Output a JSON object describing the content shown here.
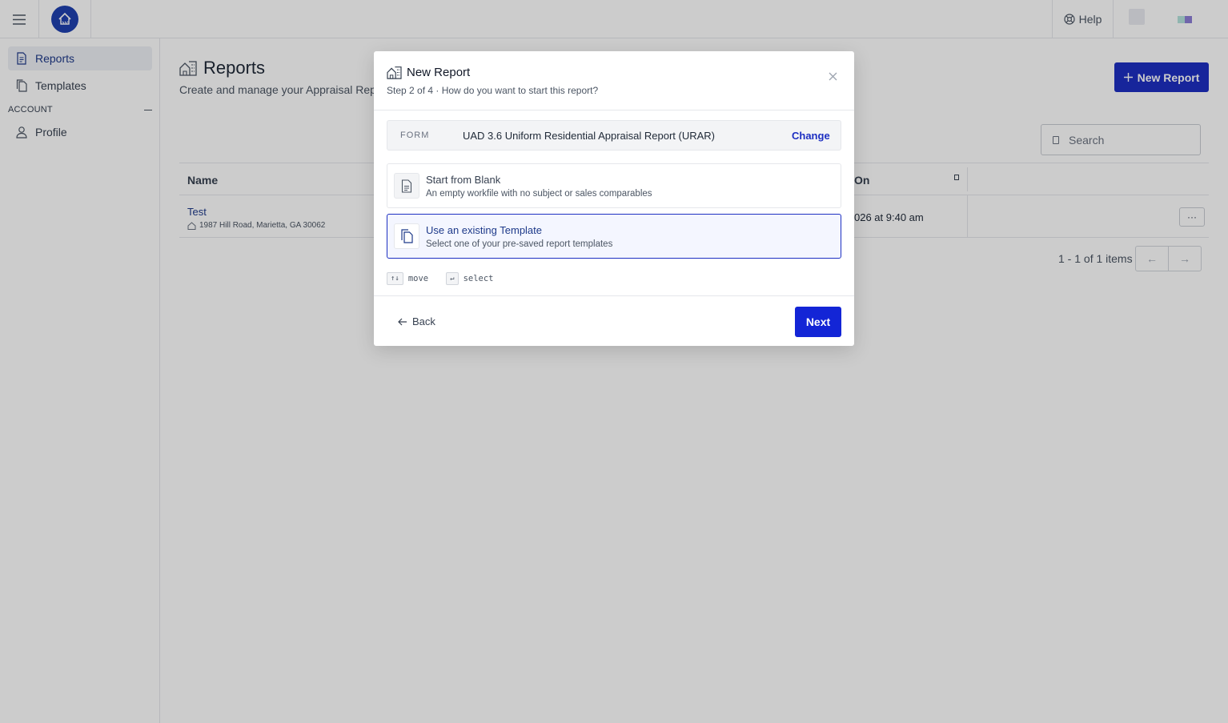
{
  "topbar": {
    "help_label": "Help"
  },
  "sidebar": {
    "items": [
      {
        "label": "Reports",
        "icon": "document-icon"
      },
      {
        "label": "Templates",
        "icon": "copy-icon"
      }
    ],
    "section_label": "ACCOUNT",
    "account_items": [
      {
        "label": "Profile",
        "icon": "user-icon"
      }
    ]
  },
  "main": {
    "title": "Reports",
    "subtitle": "Create and manage your Appraisal Reports",
    "new_report_label": "New Report",
    "search_placeholder": "Search",
    "table": {
      "columns": [
        "Name",
        "On"
      ],
      "rows": [
        {
          "name": "Test",
          "address": "1987 Hill Road, Marietta, GA 30062",
          "date": "026 at 9:40 am"
        }
      ]
    },
    "pagination_text": "1 - 1 of 1 items"
  },
  "modal": {
    "title": "New Report",
    "subtitle": "Step 2 of 4 · How do you want to start this report?",
    "form_label": "FORM",
    "form_value": "UAD 3.6 Uniform Residential Appraisal Report (URAR)",
    "change_label": "Change",
    "options": [
      {
        "title": "Start from Blank",
        "description": "An empty workfile with no subject or sales comparables",
        "selected": false,
        "icon": "blank-document-icon"
      },
      {
        "title": "Use an existing Template",
        "description": "Select one of your pre-saved report templates",
        "selected": true,
        "icon": "copy-icon"
      }
    ],
    "hints": {
      "move_key": "↑↓",
      "move_label": "move",
      "select_key": "↵",
      "select_label": "select"
    },
    "back_label": "Back",
    "next_label": "Next"
  },
  "colors": {
    "primary": "#1d2fc2",
    "overlay": "rgba(0,0,0,0.2)"
  }
}
